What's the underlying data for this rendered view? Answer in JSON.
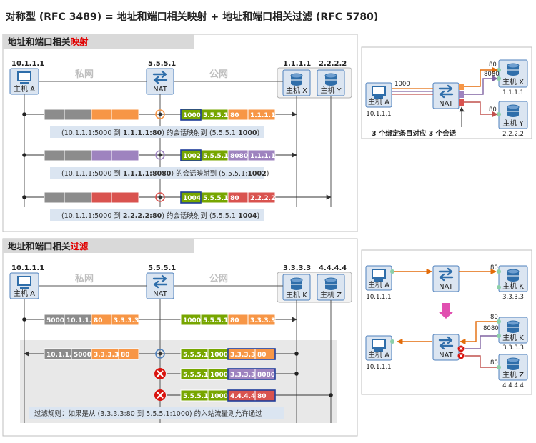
{
  "title": "对称型 (RFC 3489) = 地址和端口相关映射 + 地址和端口相关过滤 (RFC 5780)",
  "colors": {
    "gray": "#8c8c8c",
    "orange": "#f79646",
    "green": "#77a600",
    "purple": "#9e83bf",
    "red": "#d9534f",
    "blue_box": "#dbe5f1",
    "blue_border": "#4f81bd",
    "icon_blue": "#2f6eaa",
    "panel_header": "#d9d9d9",
    "highlight": "#1f3d9a"
  },
  "icons": [
    "computer-icon",
    "router-icon",
    "database-icon",
    "error-x-icon",
    "arrow-down-icon"
  ],
  "section1": {
    "header_prefix": "地址和端口相关",
    "header_suffix": "映射",
    "private_label": "私网",
    "public_label": "公网",
    "host_a_ip": "10.1.1.1",
    "host_a_label": "主机 A",
    "nat_ip": "5.5.5.1",
    "nat_label": "NAT",
    "host_x_ip": "1.1.1.1",
    "host_x_label": "主机 X",
    "host_y_ip": "2.2.2.2",
    "host_y_label": "主机 Y",
    "flows": [
      {
        "in": [
          "5000",
          "10.1.1.1",
          "80",
          "1.1.1.1"
        ],
        "out": [
          "1000",
          "5.5.5.1",
          "80",
          "1.1.1.1"
        ],
        "caption_parts": [
          "(10.1.1.1:5000 到 ",
          "1.1.1.1:80",
          ") 的会话映射到 (5.5.5.1:",
          "1000",
          ")"
        ]
      },
      {
        "in": [
          "5000",
          "10.1.1.1",
          "8080",
          "1.1.1.1"
        ],
        "out": [
          "1002",
          "5.5.5.1",
          "8080",
          "1.1.1.1"
        ],
        "caption_parts": [
          "(10.1.1.1:5000 到 ",
          "1.1.1.1:8080",
          ") 的会话映射到 (5.5.5.1:",
          "1002",
          ")"
        ]
      },
      {
        "in": [
          "5000",
          "10.1.1.1",
          "80",
          "2.2.2.2"
        ],
        "out": [
          "1004",
          "5.5.5.1",
          "80",
          "2.2.2.2"
        ],
        "caption_parts": [
          "(10.1.1.1:5000 到 ",
          "2.2.2.2:80",
          ") 的会话映射到 (5.5.5.1:",
          "1004",
          ")"
        ]
      }
    ]
  },
  "section2": {
    "header_prefix": "地址和端口相关",
    "header_suffix": "过滤",
    "private_label": "私网",
    "public_label": "公网",
    "host_a_ip": "10.1.1.1",
    "host_a_label": "主机 A",
    "nat_ip": "5.5.5.1",
    "nat_label": "NAT",
    "host_k_ip": "3.3.3.3",
    "host_k_label": "主机 K",
    "host_z_ip": "4.4.4.4",
    "host_z_label": "主机 Z",
    "outbound": {
      "in": [
        "5000",
        "10.1.1.1",
        "80",
        "3.3.3.3"
      ],
      "out": [
        "1000",
        "5.5.5.1",
        "80",
        "3.3.3.3"
      ]
    },
    "inbound_allowed": {
      "in": [
        "5.5.5.1",
        "1000",
        "3.3.3.3",
        "80"
      ],
      "out": [
        "10.1.1.1",
        "5000",
        "3.3.3.3",
        "80"
      ]
    },
    "inbound_blocked": [
      [
        "5.5.5.1",
        "1000",
        "3.3.3.3",
        "8080"
      ],
      [
        "5.5.5.1",
        "1000",
        "4.4.4.4",
        "80"
      ]
    ],
    "rule_text": "过滤规则：如果是从 (3.3.3.3:80 到 5.5.5.1:1000) 的入站流量则允许通过"
  },
  "summary_top": {
    "host_a_label": "主机 A",
    "host_a_ip": "10.1.1.1",
    "nat_label": "NAT",
    "port_label": "1000",
    "x_label": "主机 X",
    "x_ip": "1.1.1.1",
    "x_ports": [
      "80",
      "8080"
    ],
    "y_label": "主机 Y",
    "y_ip": "2.2.2.2",
    "y_port": "80",
    "caption": "3 个绑定条目对应 3 个会话"
  },
  "summary_bottom": {
    "host_a_label": "主机 A",
    "host_a_ip": "10.1.1.1",
    "nat_label": "NAT",
    "k_label": "主机 K",
    "k_ip": "3.3.3.3",
    "k_port_top": "80",
    "k_ports": [
      "80",
      "8080"
    ],
    "z_label": "主机 Z",
    "z_ip": "4.4.4.4",
    "z_port": "80"
  }
}
